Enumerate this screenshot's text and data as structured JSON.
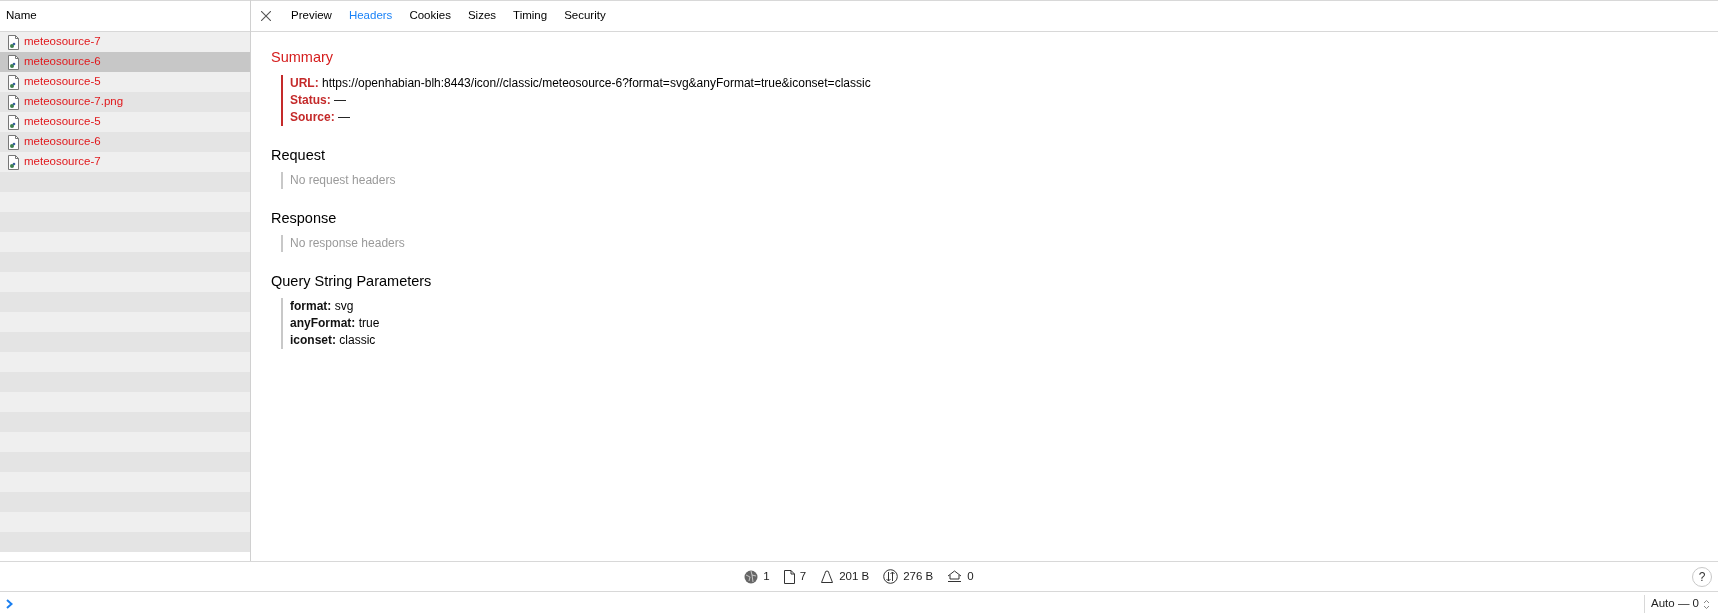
{
  "sidebar": {
    "header": "Name",
    "items": [
      {
        "label": "meteosource-7",
        "selected": false
      },
      {
        "label": "meteosource-6",
        "selected": true
      },
      {
        "label": "meteosource-5",
        "selected": false
      },
      {
        "label": "meteosource-7.png",
        "selected": false
      },
      {
        "label": "meteosource-5",
        "selected": false
      },
      {
        "label": "meteosource-6",
        "selected": false
      },
      {
        "label": "meteosource-7",
        "selected": false
      }
    ]
  },
  "tabs": [
    {
      "label": "Preview",
      "selected": false
    },
    {
      "label": "Headers",
      "selected": true
    },
    {
      "label": "Cookies",
      "selected": false
    },
    {
      "label": "Sizes",
      "selected": false
    },
    {
      "label": "Timing",
      "selected": false
    },
    {
      "label": "Security",
      "selected": false
    }
  ],
  "summary": {
    "title": "Summary",
    "fields": [
      {
        "key": "URL:",
        "value": "https://openhabian-blh:8443/icon//classic/meteosource-6?format=svg&anyFormat=true&iconset=classic"
      },
      {
        "key": "Status:",
        "value": "—"
      },
      {
        "key": "Source:",
        "value": "—"
      }
    ]
  },
  "sections": [
    {
      "title": "Request",
      "empty_text": "No request headers"
    },
    {
      "title": "Response",
      "empty_text": "No response headers"
    },
    {
      "title": "Query String Parameters",
      "params": [
        {
          "key": "format:",
          "value": "svg"
        },
        {
          "key": "anyFormat:",
          "value": "true"
        },
        {
          "key": "iconset:",
          "value": "classic"
        }
      ]
    }
  ],
  "status_bar": [
    {
      "kind": "globe",
      "value": "1"
    },
    {
      "kind": "file",
      "value": "7"
    },
    {
      "kind": "weight",
      "value": "201 B"
    },
    {
      "kind": "transfer",
      "value": "276 B"
    },
    {
      "kind": "cache",
      "value": "0"
    }
  ],
  "help_button": "?",
  "console": {
    "mode": "Auto — 0"
  }
}
